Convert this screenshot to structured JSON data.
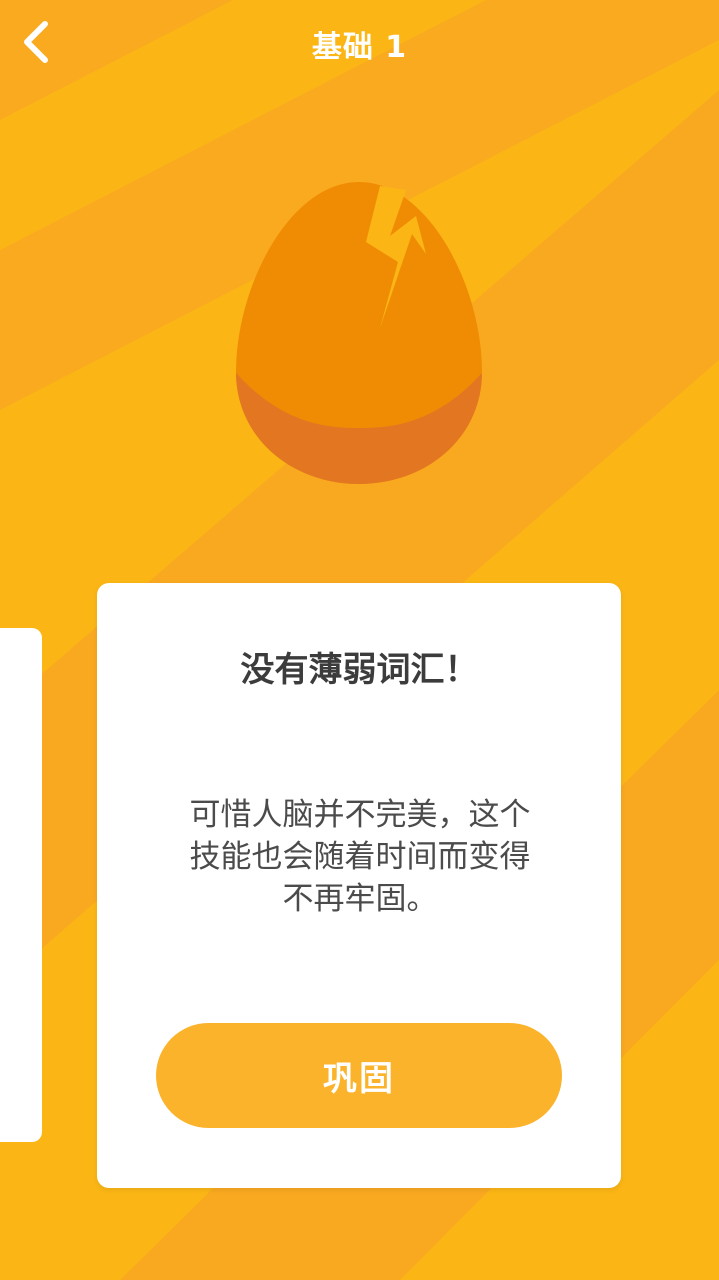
{
  "header": {
    "title": "基础 1",
    "back_icon": "chevron-left-icon"
  },
  "illustration": {
    "icon": "cracked-egg-icon"
  },
  "card": {
    "heading": "没有薄弱词汇！",
    "body_lines": [
      "可惜人脑并不完美，这个",
      "技能也会随着时间而变得",
      "不再牢固。"
    ],
    "button_label": "巩固"
  },
  "colors": {
    "background": "#fbb615",
    "stripe": "#f9a920",
    "egg_top": "#f08c03",
    "egg_bottom": "#e37620",
    "button": "#fbb32b",
    "card": "#ffffff"
  }
}
